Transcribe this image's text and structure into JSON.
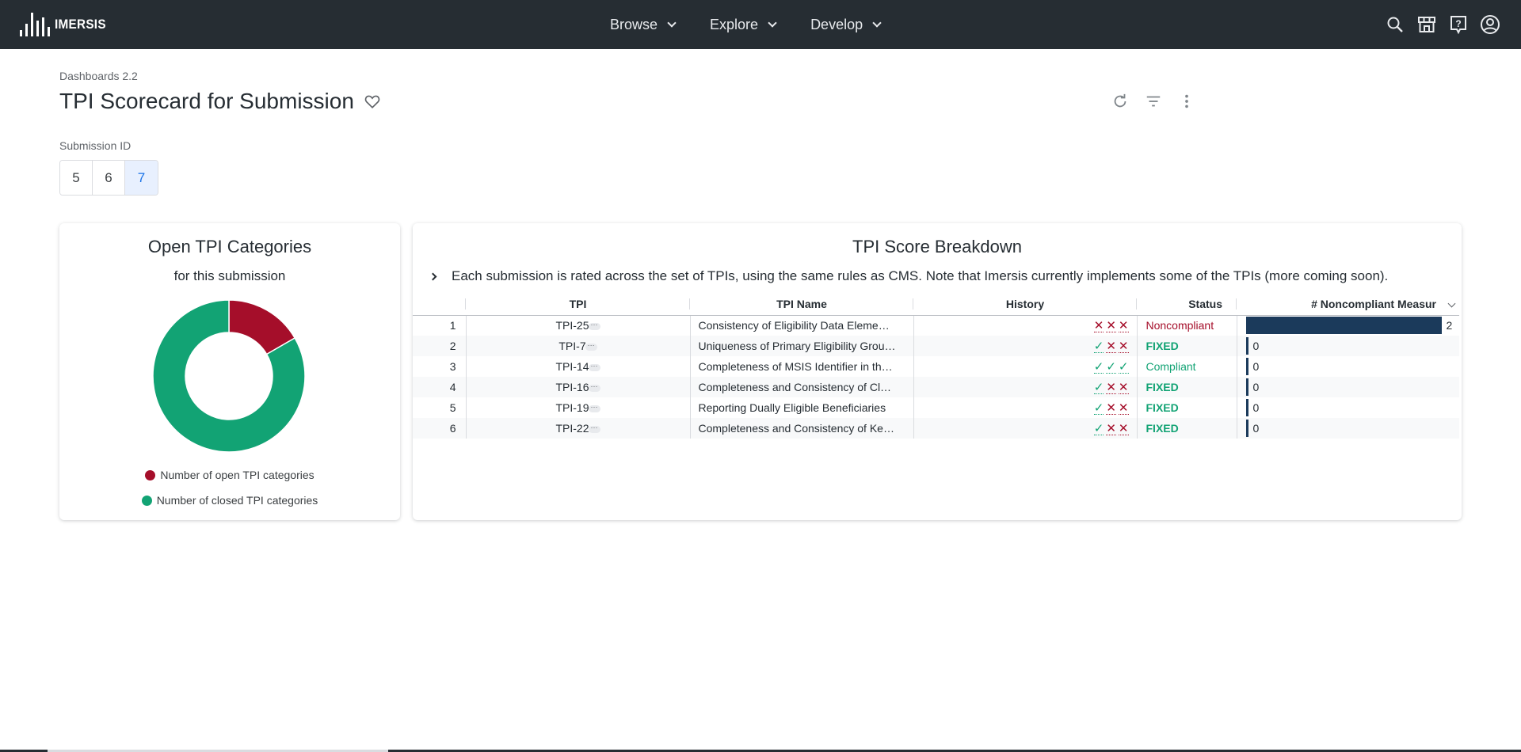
{
  "app": {
    "logo_text": "IMERSIS"
  },
  "nav": {
    "items": [
      {
        "label": "Browse"
      },
      {
        "label": "Explore"
      },
      {
        "label": "Develop"
      }
    ]
  },
  "top_icons": [
    "search-icon",
    "marketplace-icon",
    "help-icon",
    "account-icon"
  ],
  "page": {
    "breadcrumb": "Dashboards 2.2",
    "title": "TPI Scorecard for Submission"
  },
  "filter": {
    "label": "Submission ID",
    "options": [
      "5",
      "6",
      "7"
    ],
    "selected": "7"
  },
  "donut_card": {
    "title": "Open TPI Categories",
    "subtitle": "for this submission",
    "legend": [
      "Number of open TPI categories",
      "Number of closed TPI categories"
    ],
    "colors": {
      "open": "#a50e2a",
      "closed": "#12a374"
    }
  },
  "chart_data": {
    "type": "pie",
    "donut": true,
    "categories": [
      "Number of open TPI categories",
      "Number of closed TPI categories"
    ],
    "values": [
      1,
      5
    ]
  },
  "breakdown": {
    "title": "TPI Score Breakdown",
    "note": "Each submission is rated across the set of TPIs, using the same rules as CMS. Note that Imersis currently implements some of the TPIs (more coming soon).",
    "columns": {
      "tpi": "TPI",
      "name": "TPI Name",
      "history": "History",
      "status": "Status",
      "noncompliant": "# Noncompliant Measur"
    },
    "pill": "···",
    "rows": [
      {
        "idx": "1",
        "tpi": "TPI-25",
        "name": "Consistency of Eligibility Data Eleme…",
        "history": [
          "x",
          "x",
          "x"
        ],
        "status": "Noncompliant",
        "status_kind": "nc",
        "count": 2
      },
      {
        "idx": "2",
        "tpi": "TPI-7",
        "name": "Uniqueness of Primary Eligibility Grou…",
        "history": [
          "c",
          "x",
          "x"
        ],
        "status": "FIXED",
        "status_kind": "fixed",
        "count": 0
      },
      {
        "idx": "3",
        "tpi": "TPI-14",
        "name": "Completeness of MSIS Identifier in th…",
        "history": [
          "c",
          "c",
          "c"
        ],
        "status": "Compliant",
        "status_kind": "comp",
        "count": 0
      },
      {
        "idx": "4",
        "tpi": "TPI-16",
        "name": "Completeness and Consistency of Cl…",
        "history": [
          "c",
          "x",
          "x"
        ],
        "status": "FIXED",
        "status_kind": "fixed",
        "count": 0
      },
      {
        "idx": "5",
        "tpi": "TPI-19",
        "name": "Reporting Dually Eligible Beneficiaries",
        "history": [
          "c",
          "x",
          "x"
        ],
        "status": "FIXED",
        "status_kind": "fixed",
        "count": 0
      },
      {
        "idx": "6",
        "tpi": "TPI-22",
        "name": "Completeness and Consistency of Ke…",
        "history": [
          "c",
          "x",
          "x"
        ],
        "status": "FIXED",
        "status_kind": "fixed",
        "count": 0
      }
    ],
    "bar_max": 2,
    "bar_color": "#1b3a5b"
  }
}
